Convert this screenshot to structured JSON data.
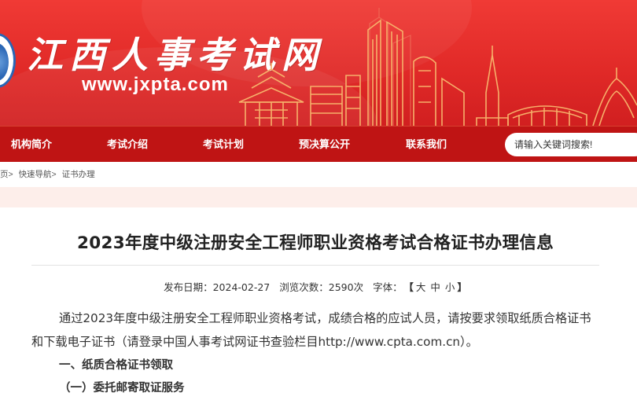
{
  "banner": {
    "site_name": "江西人事考试网",
    "site_url": "www.jxpta.com"
  },
  "nav": {
    "items": [
      {
        "label": "机构简介"
      },
      {
        "label": "考试介绍"
      },
      {
        "label": "考试计划"
      },
      {
        "label": "预决算公开"
      },
      {
        "label": "联系我们"
      }
    ],
    "search_placeholder": "请输入关键词搜索!"
  },
  "breadcrumb": {
    "items": [
      "页>",
      "快速导航>",
      "证书办理"
    ]
  },
  "article": {
    "title": "2023年度中级注册安全工程师职业资格考试合格证书办理信息",
    "meta": {
      "date_label": "发布日期：",
      "date": "2024-02-27",
      "views_label": "浏览次数：",
      "views": "2590次",
      "font_label": "字体：",
      "font_open": "【",
      "font_large": "大",
      "font_medium": "中",
      "font_small": "小",
      "font_close": "】"
    },
    "intro": "通过2023年度中级注册安全工程师职业资格考试，成绩合格的应试人员，请按要求领取纸质合格证书和下载电子证书（请登录中国人事考试网证书查验栏目http://www.cpta.com.cn）。",
    "section1": "一、纸质合格证书领取",
    "section1_1": "（一）委托邮寄取证服务"
  },
  "colors": {
    "banner_red": "#e12a28",
    "nav_red": "#bf1414",
    "band_pink": "#fdeeea",
    "building_gold": "#f6b06a"
  }
}
